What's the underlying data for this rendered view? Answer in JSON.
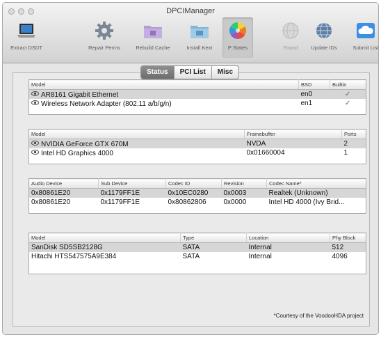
{
  "window": {
    "title": "DPCIManager"
  },
  "colors": {
    "accent_toolbar": "#3d8fe3",
    "row_selected": "#d6d6d6",
    "tab_selected": "#7b7b7b"
  },
  "toolbar": {
    "items": [
      {
        "label": "Extract DSDT",
        "icon": "laptop-icon",
        "enabled": true
      },
      {
        "label": "Repair Perms",
        "icon": "gear-icon",
        "enabled": true
      },
      {
        "label": "Rebuild Cache",
        "icon": "folder-icon",
        "enabled": true
      },
      {
        "label": "Install Kext",
        "icon": "folder-icon",
        "enabled": true
      },
      {
        "label": "P States",
        "icon": "color-wheel-icon",
        "enabled": true,
        "selected": true
      },
      {
        "label": "Found",
        "icon": "globe-icon",
        "enabled": false
      },
      {
        "label": "Update IDs",
        "icon": "globe-icon",
        "enabled": true
      },
      {
        "label": "Submit List",
        "icon": "cloud-icon",
        "enabled": true
      }
    ]
  },
  "tabs": [
    {
      "label": "Status",
      "selected": true
    },
    {
      "label": "PCI List",
      "selected": false
    },
    {
      "label": "Misc",
      "selected": false
    }
  ],
  "network": {
    "headers": [
      "Model",
      "BSD",
      "Builtin"
    ],
    "rows": [
      {
        "model": "AR8161 Gigabit Ethernet",
        "bsd": "en0",
        "builtin": "✓"
      },
      {
        "model": "Wireless Network Adapter (802.11 a/b/g/n)",
        "bsd": "en1",
        "builtin": "✓"
      }
    ]
  },
  "graphics": {
    "headers": [
      "Model",
      "Framebuffer",
      "Ports"
    ],
    "rows": [
      {
        "model": "NVIDIA GeForce GTX 670M",
        "framebuffer": "NVDA",
        "ports": "2"
      },
      {
        "model": "Intel HD Graphics 4000",
        "framebuffer": "0x01660004",
        "ports": "1"
      }
    ]
  },
  "audio": {
    "headers": [
      "Audio Device",
      "Sub Device",
      "Codec ID",
      "Revision",
      "Codec Name*"
    ],
    "rows": [
      {
        "device": "0x80861E20",
        "sub": "0x1179FF1E",
        "codec_id": "0x10EC0280",
        "revision": "0x0003",
        "codec_name": "Realtek (Unknown)"
      },
      {
        "device": "0x80861E20",
        "sub": "0x1179FF1E",
        "codec_id": "0x80862806",
        "revision": "0x0000",
        "codec_name": "Intel HD 4000 (Ivy Brid..."
      }
    ]
  },
  "storage": {
    "headers": [
      "Model",
      "Type",
      "Location",
      "Phy Block"
    ],
    "rows": [
      {
        "model": "SanDisk SD5SB2128G",
        "type": "SATA",
        "location": "Internal",
        "block": "512"
      },
      {
        "model": "Hitachi HTS547575A9E384",
        "type": "SATA",
        "location": "Internal",
        "block": "4096"
      }
    ]
  },
  "footer": {
    "courtesy": "*Courtesy of the VoodooHDA project"
  }
}
